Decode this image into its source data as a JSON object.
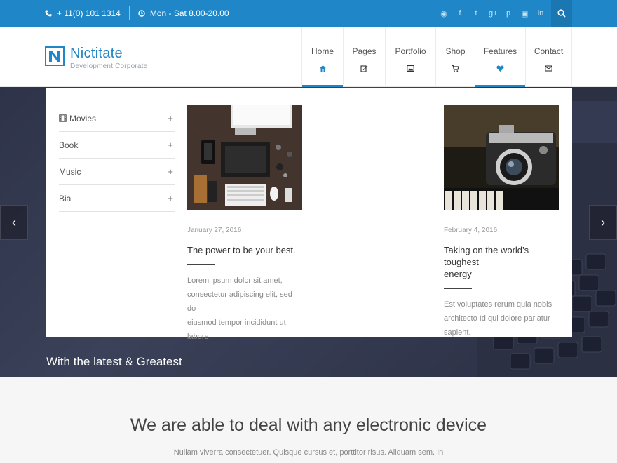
{
  "topbar": {
    "phone": "+ 11(0) 101 1314",
    "hours": "Mon - Sat 8.00-20.00",
    "social_icons": [
      "rss-icon",
      "facebook-icon",
      "twitter-icon",
      "google-plus-icon",
      "pinterest-icon",
      "instagram-icon",
      "linkedin-icon"
    ],
    "social_glyphs": [
      "◉",
      "f",
      "t",
      "g+",
      "p",
      "▣",
      "in"
    ],
    "search_icon": "search-icon"
  },
  "logo": {
    "name": "Nictitate",
    "tagline": "Development Corporate"
  },
  "nav": [
    {
      "label": "Home",
      "icon": "home-icon",
      "active": true
    },
    {
      "label": "Pages",
      "icon": "edit-icon",
      "active": false
    },
    {
      "label": "Portfolio",
      "icon": "image-icon",
      "active": false
    },
    {
      "label": "Shop",
      "icon": "cart-icon",
      "active": false
    },
    {
      "label": "Features",
      "icon": "heart-icon",
      "active": true
    },
    {
      "label": "Contact",
      "icon": "envelope-icon",
      "active": false
    }
  ],
  "mega": {
    "categories": [
      {
        "label": "Movies",
        "icon": "film-icon"
      },
      {
        "label": "Book"
      },
      {
        "label": "Music"
      },
      {
        "label": "Bia"
      }
    ],
    "posts": [
      {
        "date": "January 27, 2016",
        "title": "The power to be your best.",
        "excerpt_lines": [
          "Lorem ipsum dolor sit amet,",
          "consectetur adipiscing elit, sed do",
          "eiusmod tempor incididunt ut labore"
        ]
      },
      {
        "date": "February 4, 2016",
        "title_lines": [
          "Taking on the world’s toughest",
          "energy"
        ],
        "excerpt_lines": [
          "Est voluptates rerum quia nobis",
          "architecto Id qui dolore pariatur",
          "sapient."
        ]
      }
    ]
  },
  "hero": {
    "caption": "With the latest & Greatest",
    "prev": "‹",
    "next": "›"
  },
  "section": {
    "heading": "We are able to deal with any electronic device",
    "text": "Nullam viverra consectetuer. Quisque cursus et, porttitor risus. Aliquam sem. In"
  },
  "colors": {
    "brand": "#1f86c7",
    "topbar": "#1f86c7",
    "search_bg": "#1a77b2"
  }
}
